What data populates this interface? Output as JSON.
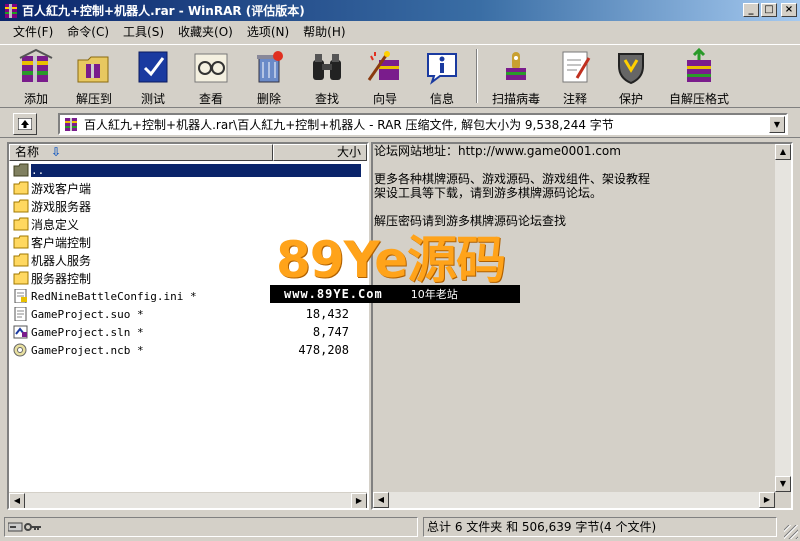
{
  "window": {
    "title": "百人紅九+控制+机器人.rar - WinRAR (评估版本)"
  },
  "menu": [
    "文件(F)",
    "命令(C)",
    "工具(S)",
    "收藏夹(O)",
    "选项(N)",
    "帮助(H)"
  ],
  "toolbar": {
    "add": "添加",
    "extract": "解压到",
    "test": "测试",
    "view": "查看",
    "delete": "删除",
    "find": "查找",
    "wizard": "向导",
    "info": "信息",
    "scan": "扫描病毒",
    "comment": "注释",
    "protect": "保护",
    "sfx": "自解压格式"
  },
  "address": {
    "path": "百人紅九+控制+机器人.rar\\百人紅九+控制+机器人 - RAR 压缩文件, 解包大小为 9,538,244 字节"
  },
  "columns": {
    "name": "名称",
    "size": "大小"
  },
  "files": [
    {
      "name": "..",
      "size": "",
      "type": "parent"
    },
    {
      "name": "游戏客户端",
      "size": "",
      "type": "folder"
    },
    {
      "name": "游戏服务器",
      "size": "",
      "type": "folder"
    },
    {
      "name": "消息定义",
      "size": "",
      "type": "folder"
    },
    {
      "name": "客户端控制",
      "size": "",
      "type": "folder"
    },
    {
      "name": "机器人服务",
      "size": "",
      "type": "folder"
    },
    {
      "name": "服务器控制",
      "size": "",
      "type": "folder"
    },
    {
      "name": "RedNineBattleConfig.ini *",
      "size": "",
      "type": "ini"
    },
    {
      "name": "GameProject.suo *",
      "size": "18,432",
      "type": "suo"
    },
    {
      "name": "GameProject.sln *",
      "size": "8,747",
      "type": "sln"
    },
    {
      "name": "GameProject.ncb *",
      "size": "478,208",
      "type": "ncb"
    }
  ],
  "comment_lines": [
    "论坛网站地址：http://www.game0001.com",
    "",
    "更多各种棋牌源码、游戏源码、游戏组件、架设教程",
    "架设工具等下载，请到游多棋牌源码论坛。",
    "",
    "解压密码请到游多棋牌源码论坛查找"
  ],
  "watermark": {
    "big": "89Ye源码",
    "url": "www.89YE.Com",
    "tag": "10年老站"
  },
  "status": {
    "summary": "总计 6 文件夹 和 506,639 字节(4 个文件)"
  },
  "colors": {
    "title_start": "#0a246a",
    "title_end": "#a6caf0",
    "selection": "#0a246a",
    "watermark": "#ffa31a"
  }
}
